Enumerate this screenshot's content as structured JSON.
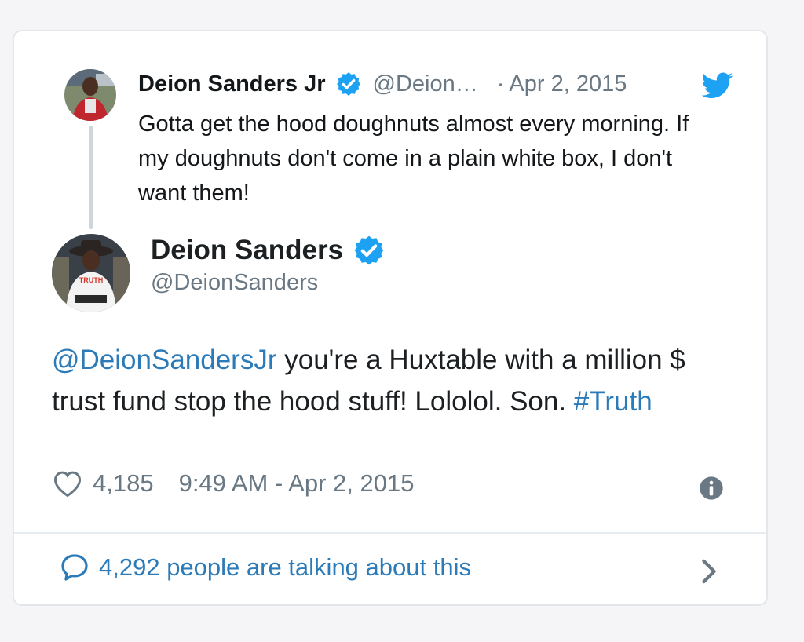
{
  "parent_tweet": {
    "name": "Deion Sanders Jr",
    "handle": "@Deion…",
    "dot": "·",
    "date": "Apr 2, 2015",
    "text": "Gotta get the hood doughnuts almost every morning. If my doughnuts don't come in a plain white box, I don't want them!"
  },
  "main_tweet": {
    "name": "Deion Sanders",
    "handle": "@DeionSanders",
    "mention": "@DeionSandersJr",
    "text_body": " you're a Huxtable with a million $ trust fund stop the hood stuff! Lololol. Son. ",
    "hashtag": "#Truth",
    "like_count": "4,185",
    "timestamp": "9:49 AM - Apr 2, 2015",
    "avatar_shirt_text": "TRUTH"
  },
  "footer": {
    "talking_text": "4,292 people are talking about this"
  },
  "colors": {
    "link": "#2b7bb9",
    "verified": "#1da1f2",
    "muted": "#697883",
    "text": "#1c2022"
  },
  "icons": [
    "verified-badge-icon",
    "twitter-bird-icon",
    "heart-icon",
    "info-icon",
    "speech-bubble-icon",
    "chevron-right-icon"
  ]
}
